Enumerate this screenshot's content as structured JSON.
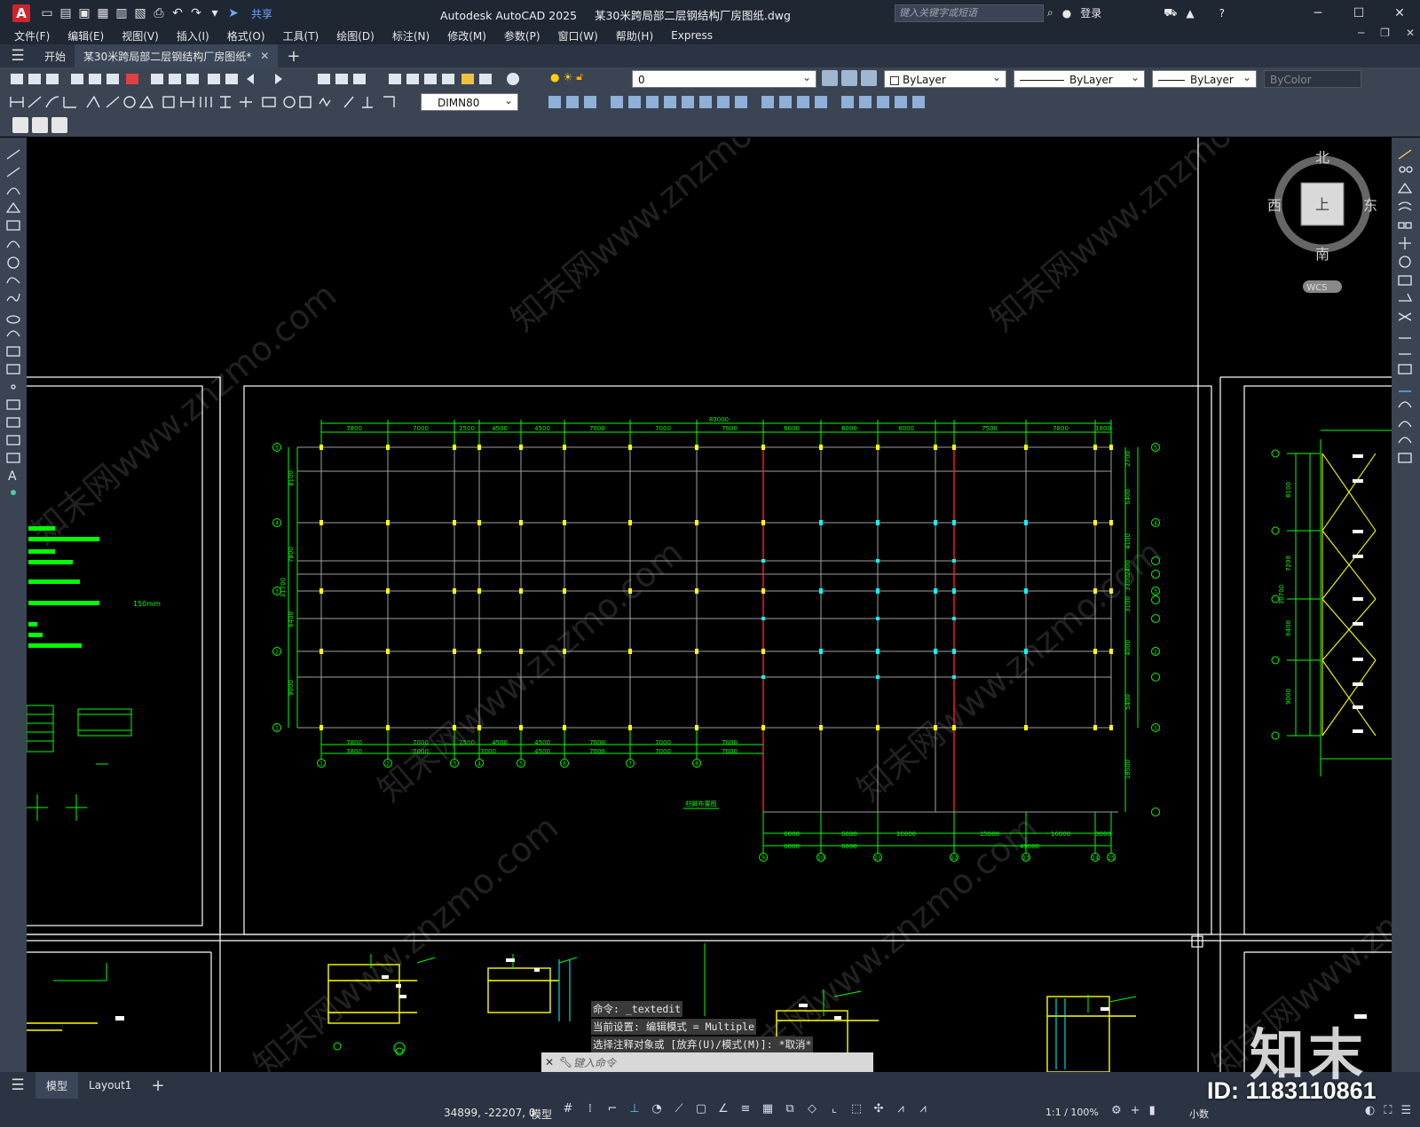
{
  "titlebar": {
    "logo": "A",
    "share": "共享",
    "app_title": "Autodesk AutoCAD 2025",
    "file_title": "某30米跨局部二层钢结构厂房图纸.dwg",
    "search_placeholder": "键入关键字或短语",
    "login": "登录"
  },
  "menu": [
    "文件(F)",
    "编辑(E)",
    "视图(V)",
    "插入(I)",
    "格式(O)",
    "工具(T)",
    "绘图(D)",
    "标注(N)",
    "修改(M)",
    "参数(P)",
    "窗口(W)",
    "帮助(H)",
    "Express"
  ],
  "tabs": {
    "start": "开始",
    "doc": "某30米跨局部二层钢结构厂房图纸*"
  },
  "properties": {
    "layer": "0",
    "color": "ByLayer",
    "linetype": "ByLayer",
    "lineweight": "ByLayer",
    "plotstyle": "ByColor",
    "dimstyle": "DIMN80"
  },
  "viewcube": {
    "north": "北",
    "south": "南",
    "east": "东",
    "west": "西",
    "top": "上",
    "wcs": "WCS"
  },
  "drawing": {
    "overall_dim": "83000",
    "top_dims": [
      "7800",
      "7000",
      "2500",
      "4500",
      "4500",
      "7000",
      "7000",
      "7000",
      "6000",
      "6000",
      "8000",
      "7500",
      "7800",
      "1800"
    ],
    "bottom_dims_row1": [
      "7800",
      "7000",
      "2500",
      "4500",
      "4500",
      "7000",
      "7000",
      "7000"
    ],
    "bottom_dims_row2": [
      "7800",
      "7000",
      "7000",
      "4500",
      "7000",
      "7000",
      "7000"
    ],
    "sub_dims_row1": [
      "6000",
      "6000",
      "16000",
      "15000",
      "16000",
      "3000"
    ],
    "sub_dims_row2": [
      "6000",
      "6000",
      "49000"
    ],
    "left_dims": [
      "8100",
      "7800",
      "6400",
      "9000"
    ],
    "left_total": "31700",
    "right_dims": [
      "2700",
      "5400",
      "4100",
      "2400",
      "3700",
      "3100",
      "4000",
      "5400"
    ],
    "right_lower": "18500",
    "plan_label": "柱脚布置图",
    "axis_labels_left": [
      "5",
      "4",
      "3",
      "2",
      "1"
    ],
    "axis_labels_bottom": [
      "1",
      "2",
      "3",
      "4",
      "5",
      "6",
      "7",
      "8"
    ],
    "axis_labels_sub": [
      "9",
      "10",
      "11",
      "12",
      "13",
      "14",
      "15"
    ],
    "side_note": "150mm",
    "right_side_dims": [
      "8100",
      "7200",
      "6400",
      "9000"
    ],
    "right_side_total": "30700"
  },
  "command": {
    "line1": "命令: _textedit",
    "line2": "当前设置: 编辑模式 = Multiple",
    "line3": "选择注释对象或 [放弃(U)/模式(M)]: *取消*",
    "placeholder": "键入命令"
  },
  "layouts": [
    "模型",
    "Layout1"
  ],
  "status": {
    "coords": "34899, -22207, 0",
    "model": "模型",
    "scale": "1:1 / 100%",
    "units": "小数"
  },
  "watermark": {
    "logo": "知末",
    "id": "ID: 1183110861",
    "site": "知末网www.znzmo.com"
  },
  "colors": {
    "green": "#00ff00",
    "yellow": "#ffff00",
    "red": "#ff2020",
    "cyan": "#00ffff",
    "grey": "#a0a0a0"
  }
}
